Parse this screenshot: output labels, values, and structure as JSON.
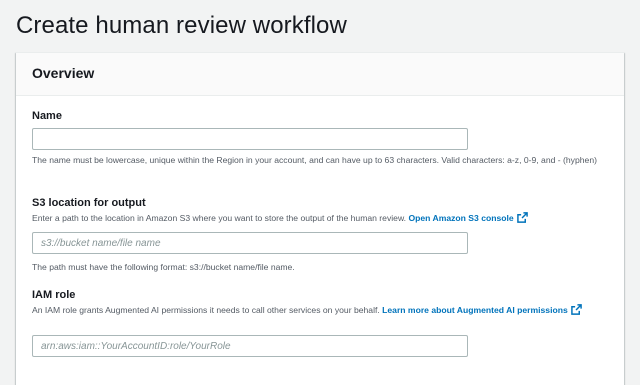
{
  "page": {
    "title": "Create human review workflow"
  },
  "overview": {
    "heading": "Overview",
    "name": {
      "label": "Name",
      "value": "",
      "placeholder": "",
      "description": "The name must be lowercase, unique within the Region in your account, and can have up to 63 characters. Valid characters: a-z, 0-9, and - (hyphen)"
    },
    "s3_output": {
      "label": "S3 location for output",
      "description": "Enter a path to the location in Amazon S3 where you want to store the output of the human review.",
      "link_text": "Open Amazon S3 console",
      "value": "",
      "placeholder": "s3://bucket name/file name",
      "hint": "The path must have the following format: s3://bucket name/file name."
    },
    "iam_role": {
      "label": "IAM role",
      "description": "An IAM role grants Augmented AI permissions it needs to call other services on your behalf.",
      "link_text": "Learn more about Augmented AI permissions",
      "value": "",
      "placeholder": "arn:aws:iam::YourAccountID:role/YourRole"
    }
  },
  "colors": {
    "link": "#0073bb",
    "background": "#f2f3f3",
    "panel_header": "#fafafa"
  },
  "icons": {
    "external_link": "external-link-icon"
  }
}
